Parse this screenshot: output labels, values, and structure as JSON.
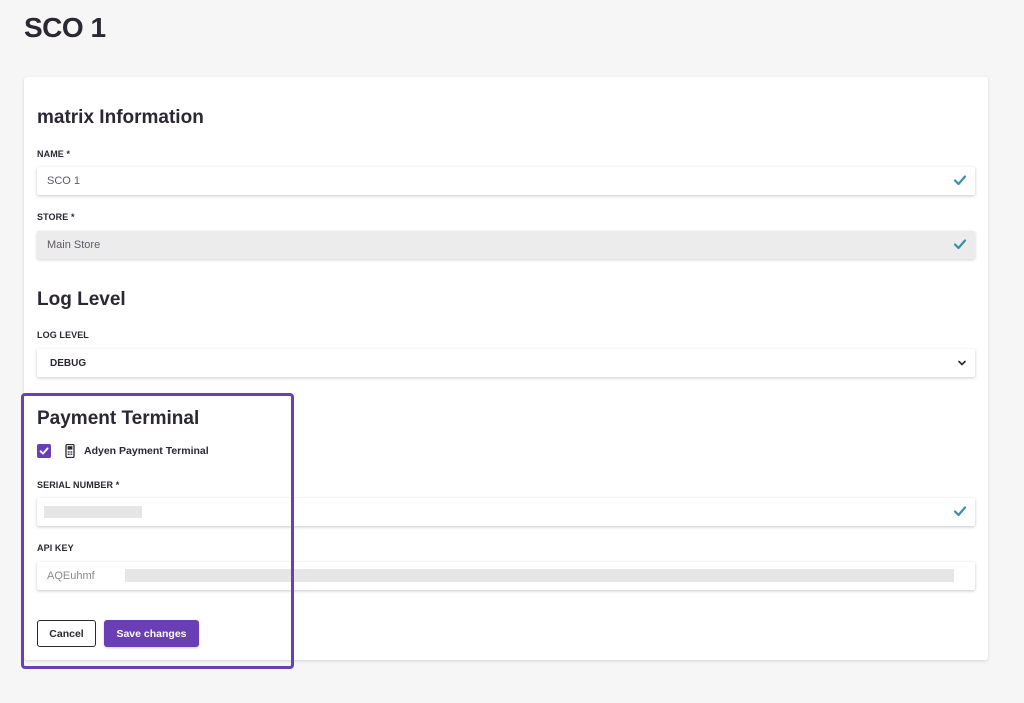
{
  "page": {
    "title": "SCO 1"
  },
  "matrix_section": {
    "title": "matrix Information",
    "name_label": "NAME",
    "name_value": "SCO 1",
    "store_label": "STORE",
    "store_value": "Main Store",
    "required_mark": "*"
  },
  "log_section": {
    "title": "Log Level",
    "label": "LOG LEVEL",
    "selected": "DEBUG"
  },
  "payment_section": {
    "title": "Payment Terminal",
    "checkbox_label": "Adyen Payment Terminal",
    "checkbox_checked": true,
    "serial_label": "SERIAL NUMBER",
    "api_key_label": "API KEY",
    "api_key_prefix": "AQEuhmf"
  },
  "actions": {
    "cancel_label": "Cancel",
    "save_label": "Save changes"
  },
  "colors": {
    "accent": "#6a3fb5",
    "check": "#3a8fa8"
  },
  "icons": {
    "valid": "check-icon",
    "dropdown": "chevron-down-icon",
    "terminal": "payment-terminal-icon"
  }
}
